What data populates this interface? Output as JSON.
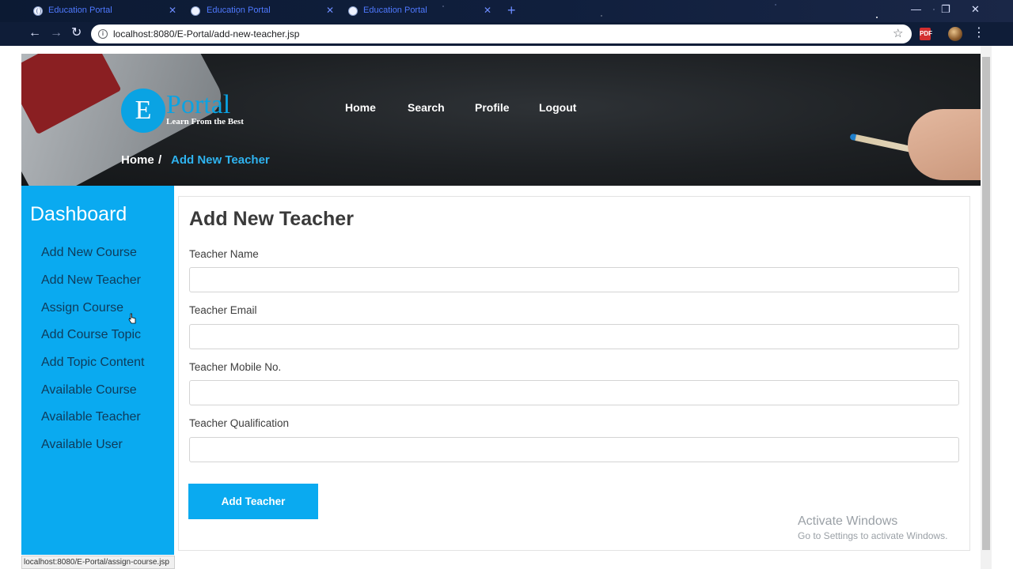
{
  "browser": {
    "tabs": [
      {
        "title": "Education Portal"
      },
      {
        "title": "Education Portal"
      },
      {
        "title": "Education Portal"
      }
    ],
    "close_glyph": "✕",
    "new_tab_glyph": "+",
    "window_controls": {
      "minimize": "—",
      "restore": "❐",
      "close": "✕"
    },
    "nav": {
      "back": "←",
      "forward": "→",
      "reload": "↻"
    },
    "url": "localhost:8080/E-Portal/add-new-teacher.jsp",
    "info_icon": "i",
    "bookmark_glyph": "☆",
    "menu_glyph": "⋮",
    "pdf_ext_label": "PDF"
  },
  "header": {
    "logo_letter": "E",
    "logo_word": "Portal",
    "logo_tagline": "Learn From the Best",
    "nav": [
      "Home",
      "Search",
      "Profile",
      "Logout"
    ],
    "breadcrumb": {
      "home": "Home",
      "separator": "/",
      "current": "Add New Teacher"
    }
  },
  "sidebar": {
    "title": "Dashboard",
    "items": [
      "Add New Course",
      "Add New Teacher",
      "Assign Course",
      "Add Course Topic",
      "Add Topic Content",
      "Available Course",
      "Available Teacher",
      "Available User"
    ]
  },
  "form": {
    "title": "Add New Teacher",
    "fields": [
      {
        "label": "Teacher Name",
        "value": ""
      },
      {
        "label": "Teacher Email",
        "value": ""
      },
      {
        "label": "Teacher Mobile No.",
        "value": ""
      },
      {
        "label": "Teacher Qualification",
        "value": ""
      }
    ],
    "submit_label": "Add Teacher"
  },
  "watermark": {
    "title": "Activate Windows",
    "subtitle": "Go to Settings to activate Windows."
  },
  "status_bar": {
    "link_preview": "localhost:8080/E-Portal/assign-course.jsp"
  },
  "colors": {
    "accent": "#0aaaf0",
    "breadcrumb_current": "#2fb3ef",
    "sidebar_text": "#0f3b5a"
  }
}
